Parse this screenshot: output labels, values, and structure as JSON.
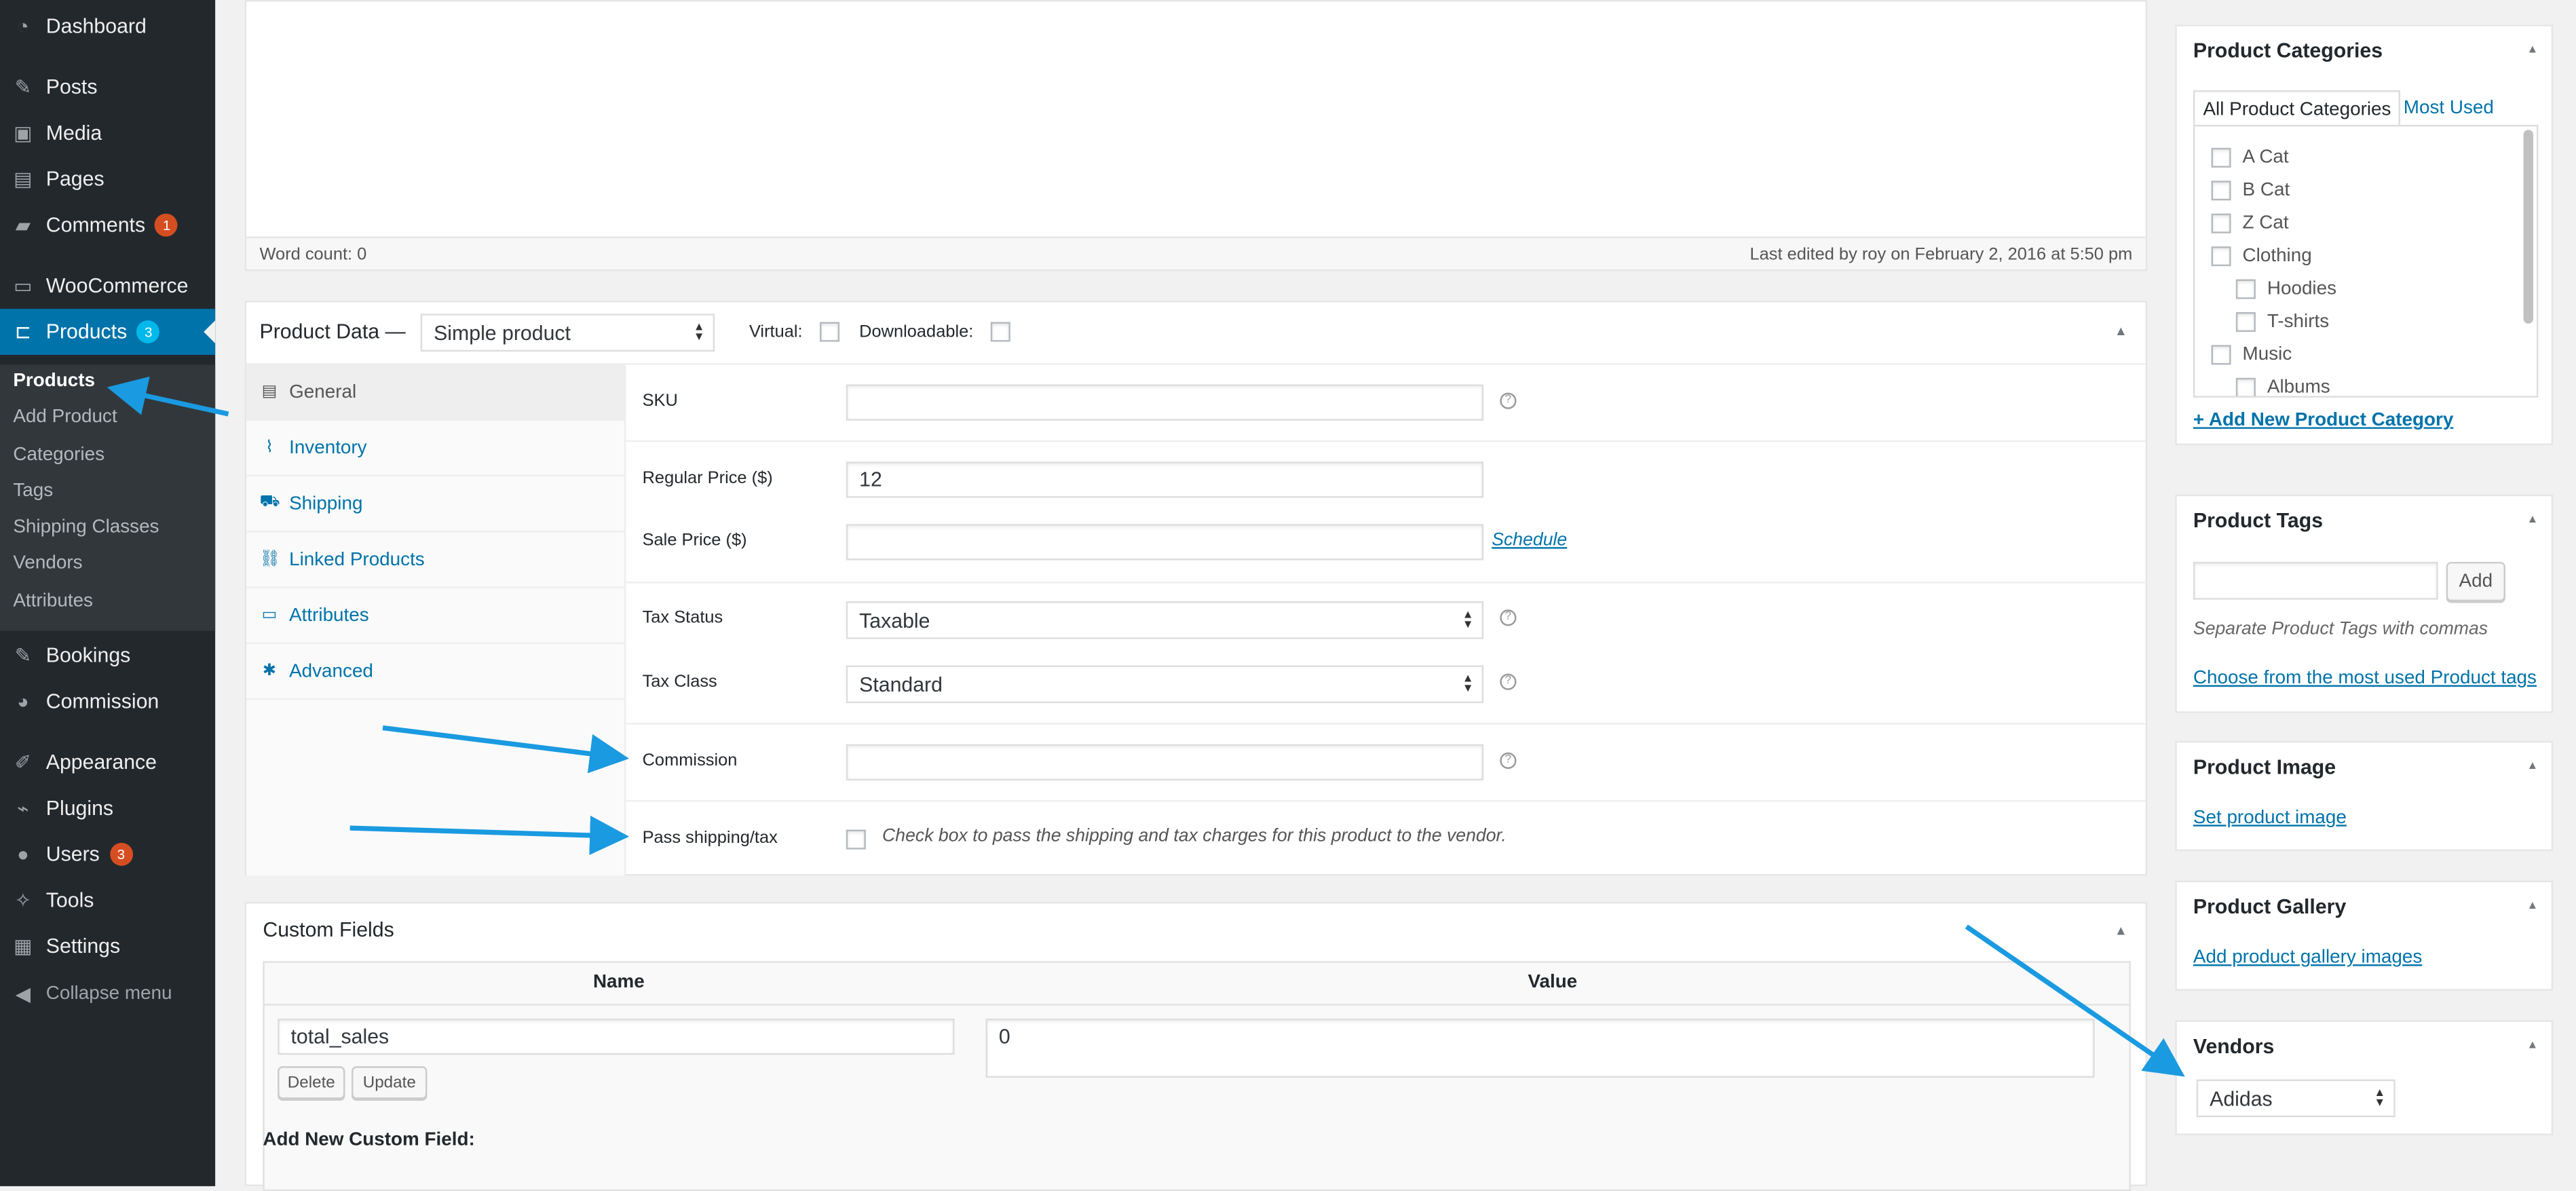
{
  "admin_menu": {
    "items": [
      {
        "label": "Dashboard",
        "icon": "dashboard-icon"
      },
      {
        "label": "Posts",
        "icon": "pin-icon"
      },
      {
        "label": "Media",
        "icon": "media-icon"
      },
      {
        "label": "Pages",
        "icon": "pages-icon"
      },
      {
        "label": "Comments",
        "icon": "comments-icon",
        "badge": "1"
      },
      {
        "label": "WooCommerce",
        "icon": "woo-icon"
      },
      {
        "label": "Products",
        "icon": "cart-icon",
        "badge": "3"
      },
      {
        "label": "Bookings",
        "icon": "pin-icon"
      },
      {
        "label": "Commission",
        "icon": "chart-pie-icon"
      },
      {
        "label": "Appearance",
        "icon": "brush-icon"
      },
      {
        "label": "Plugins",
        "icon": "plugin-icon"
      },
      {
        "label": "Users",
        "icon": "user-icon",
        "badge": "3"
      },
      {
        "label": "Tools",
        "icon": "wrench-icon"
      },
      {
        "label": "Settings",
        "icon": "settings-icon"
      }
    ],
    "submenu": [
      "Products",
      "Add Product",
      "Categories",
      "Tags",
      "Shipping Classes",
      "Vendors",
      "Attributes"
    ],
    "collapse_label": "Collapse menu"
  },
  "editor": {
    "word_count": "Word count: 0",
    "last_edited": "Last edited by roy on February 2, 2016 at 5:50 pm"
  },
  "product_data": {
    "title": "Product Data —",
    "product_type": "Simple product",
    "virtual_label": "Virtual:",
    "downloadable_label": "Downloadable:",
    "tabs": [
      "General",
      "Inventory",
      "Shipping",
      "Linked Products",
      "Attributes",
      "Advanced"
    ],
    "fields": {
      "sku_label": "SKU",
      "sku_value": "",
      "regular_price_label": "Regular Price ($)",
      "regular_price_value": "12",
      "sale_price_label": "Sale Price ($)",
      "sale_price_value": "",
      "schedule_link": "Schedule",
      "tax_status_label": "Tax Status",
      "tax_status_value": "Taxable",
      "tax_class_label": "Tax Class",
      "tax_class_value": "Standard",
      "commission_label": "Commission",
      "commission_value": "",
      "pass_shipping_label": "Pass shipping/tax",
      "pass_shipping_desc": "Check box to pass the shipping and tax charges for this product to the vendor."
    }
  },
  "custom_fields": {
    "title": "Custom Fields",
    "col_name": "Name",
    "col_value": "Value",
    "row_name": "total_sales",
    "row_value": "0",
    "delete_label": "Delete",
    "update_label": "Update",
    "add_new_label": "Add New Custom Field:"
  },
  "sidebar": {
    "categories": {
      "title": "Product Categories",
      "tab_all": "All Product Categories",
      "tab_most_used": "Most Used",
      "items": [
        {
          "label": "A Cat",
          "indent": 0
        },
        {
          "label": "B Cat",
          "indent": 0
        },
        {
          "label": "Z Cat",
          "indent": 0
        },
        {
          "label": "Clothing",
          "indent": 0
        },
        {
          "label": "Hoodies",
          "indent": 1
        },
        {
          "label": "T-shirts",
          "indent": 1
        },
        {
          "label": "Music",
          "indent": 0
        },
        {
          "label": "Albums",
          "indent": 1
        }
      ],
      "add_new_link": "+ Add New Product Category"
    },
    "tags": {
      "title": "Product Tags",
      "input_value": "",
      "add_button": "Add",
      "description": "Separate Product Tags with commas",
      "choose_link": "Choose from the most used Product tags"
    },
    "image": {
      "title": "Product Image",
      "link": "Set product image"
    },
    "gallery": {
      "title": "Product Gallery",
      "link": "Add product gallery images"
    },
    "vendors": {
      "title": "Vendors",
      "selected": "Adidas"
    }
  },
  "colors": {
    "menu_bg": "#23282d",
    "menu_current": "#0073aa",
    "link": "#0073aa",
    "badge": "#d54e21",
    "annotation_arrow": "#1a9ae0"
  }
}
